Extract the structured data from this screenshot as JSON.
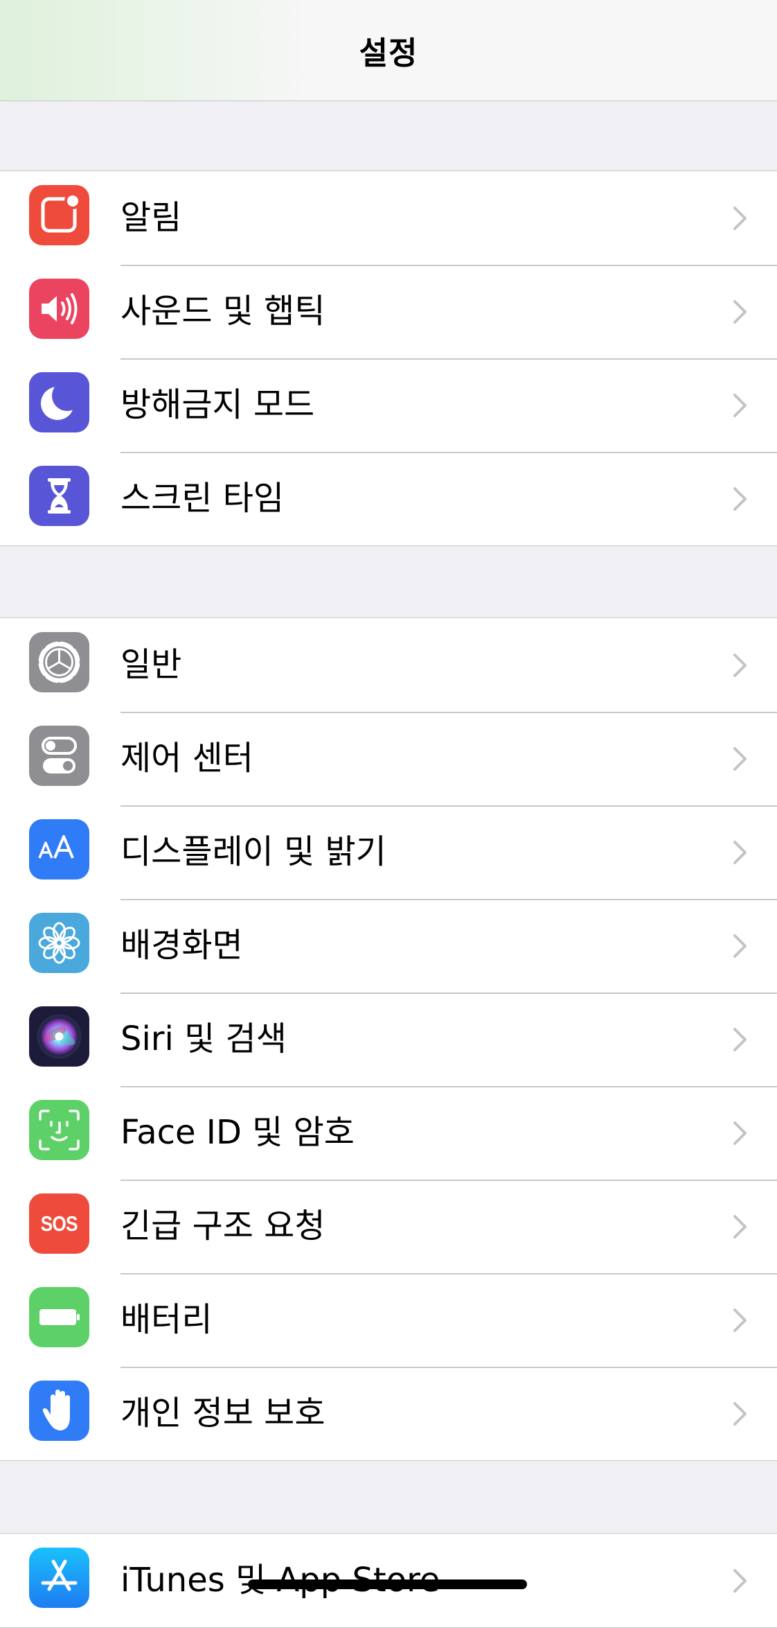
{
  "header": {
    "title": "설정"
  },
  "groups": [
    {
      "items": [
        {
          "label": "알림",
          "icon": "notifications-icon",
          "color": "#ef4b3c"
        },
        {
          "label": "사운드 및 햅틱",
          "icon": "speaker-icon",
          "color": "#eb4460"
        },
        {
          "label": "방해금지 모드",
          "icon": "moon-icon",
          "color": "#5856d6"
        },
        {
          "label": "스크린 타임",
          "icon": "hourglass-icon",
          "color": "#5856d6"
        }
      ]
    },
    {
      "items": [
        {
          "label": "일반",
          "icon": "gear-icon",
          "color": "#8e8e93"
        },
        {
          "label": "제어 센터",
          "icon": "toggle-switches-icon",
          "color": "#8e8e93"
        },
        {
          "label": "디스플레이 및 밝기",
          "icon": "text-size-icon",
          "color": "#2f7cf6"
        },
        {
          "label": "배경화면",
          "icon": "flower-icon",
          "color": "#4aa8dd"
        },
        {
          "label": "Siri 및 검색",
          "icon": "siri-icon",
          "color": "#1c1c3a"
        },
        {
          "label": "Face ID 및 암호",
          "icon": "face-id-icon",
          "color": "#5dd068"
        },
        {
          "label": "긴급 구조 요청",
          "icon": "sos-icon",
          "color": "#ef4b3c",
          "icon_text": "SOS"
        },
        {
          "label": "배터리",
          "icon": "battery-icon",
          "color": "#5dd068"
        },
        {
          "label": "개인 정보 보호",
          "icon": "hand-icon",
          "color": "#2f7cf6"
        }
      ]
    },
    {
      "items": [
        {
          "label": "iTunes 및 App Store",
          "icon": "app-store-icon",
          "color": "#1e9af5"
        }
      ]
    }
  ]
}
